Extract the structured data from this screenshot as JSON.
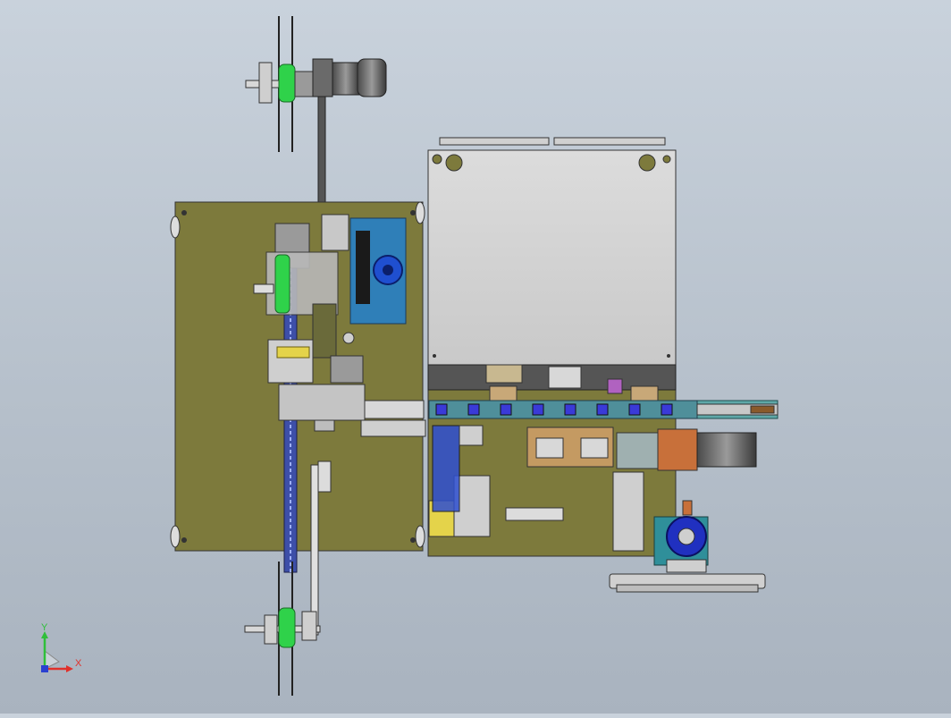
{
  "viewport": {
    "background_top": "#c9d2dc",
    "background_bottom": "#a9b3bf"
  },
  "colors": {
    "base_plate": "#7d7a3c",
    "cabinet": "#d4d4d4",
    "motor_blue": "#2f7fb8",
    "spool_green": "#2fd24a",
    "conveyor_teal": "#5fa8a8",
    "chain_blue": "#3d4fa8",
    "triad_x": "#e0302a",
    "triad_y": "#2fbf3a",
    "triad_z": "#2a40d0"
  },
  "triad": {
    "x_label": "X",
    "y_label": "Y"
  },
  "icons": [
    "coordinate-triad-icon"
  ]
}
